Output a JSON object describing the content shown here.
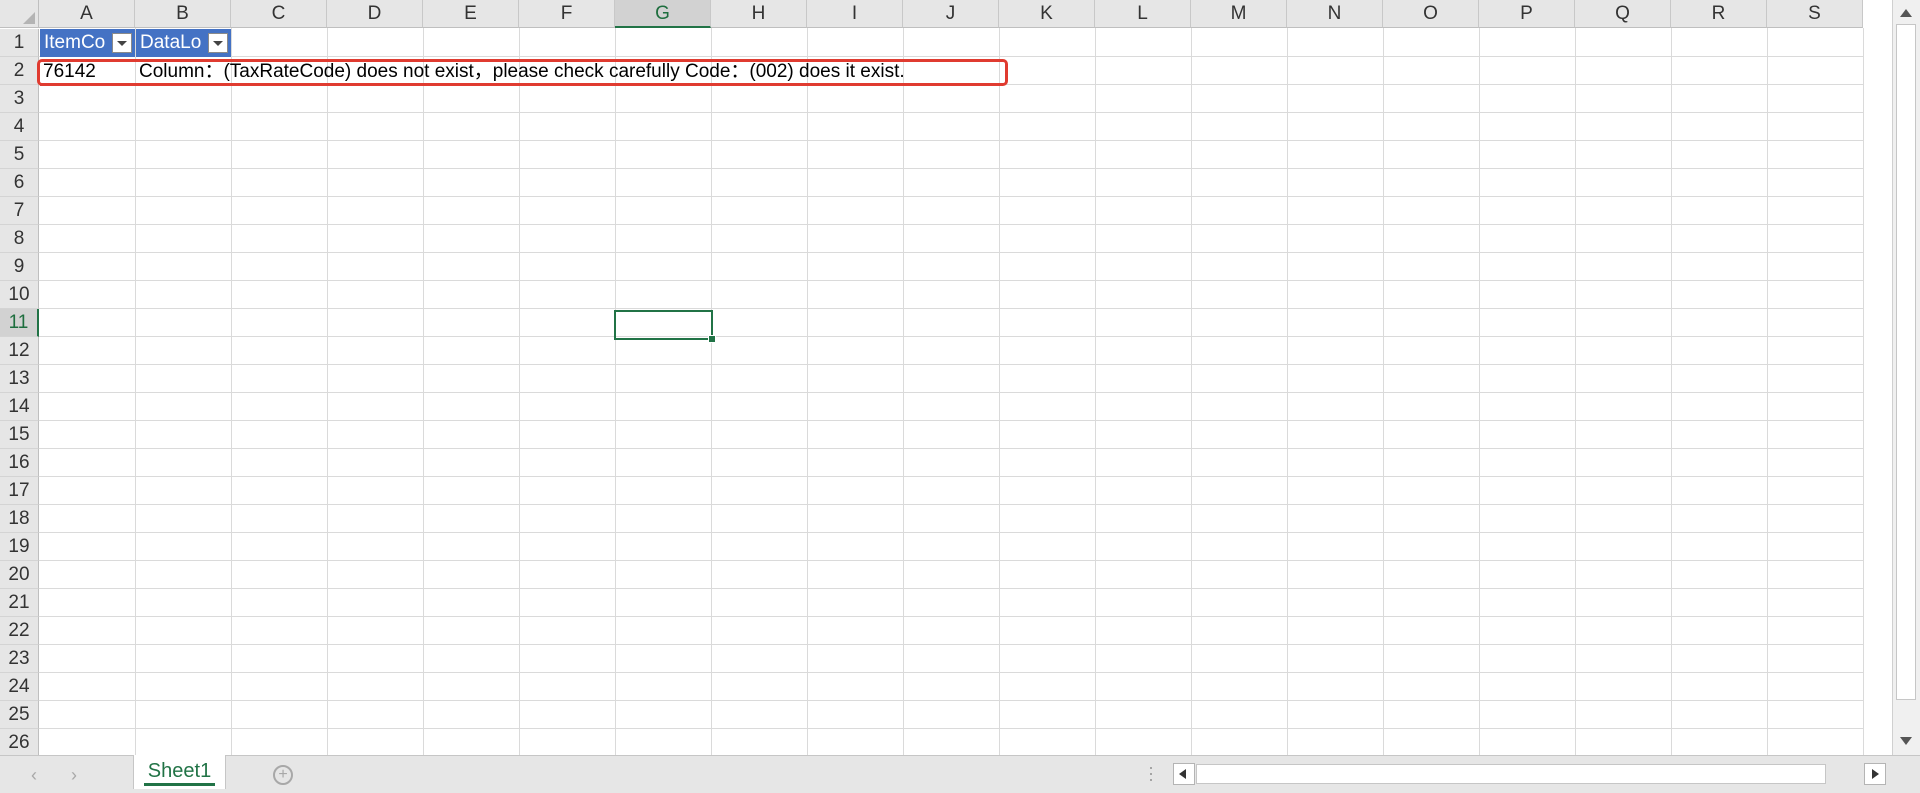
{
  "spreadsheet": {
    "columns": [
      "A",
      "B",
      "C",
      "D",
      "E",
      "F",
      "G",
      "H",
      "I",
      "J",
      "K",
      "L",
      "M",
      "N",
      "O",
      "P",
      "Q",
      "R",
      "S"
    ],
    "rows": [
      "1",
      "2",
      "3",
      "4",
      "5",
      "6",
      "7",
      "8",
      "9",
      "10",
      "11",
      "12",
      "13",
      "14",
      "15",
      "16",
      "17",
      "18",
      "19",
      "20",
      "21",
      "22",
      "23",
      "24",
      "25",
      "26"
    ],
    "active_column": "G",
    "active_row": "11",
    "table_headers": [
      "ItemCo",
      "DataLo"
    ],
    "row2": {
      "item_code": "76142",
      "data_log": "Column：(TaxRateCode) does not exist，please check carefully Code：(002) does it exist."
    }
  },
  "sheet_tabs": [
    "Sheet1"
  ],
  "colors": {
    "header_fill": "#4472c4",
    "accent": "#217346",
    "annotation": "#e03b30"
  },
  "icons": [
    "filter-dropdown-icon",
    "add-sheet-icon",
    "scroll-left-icon",
    "scroll-right-icon",
    "scroll-up-icon",
    "scroll-down-icon"
  ]
}
